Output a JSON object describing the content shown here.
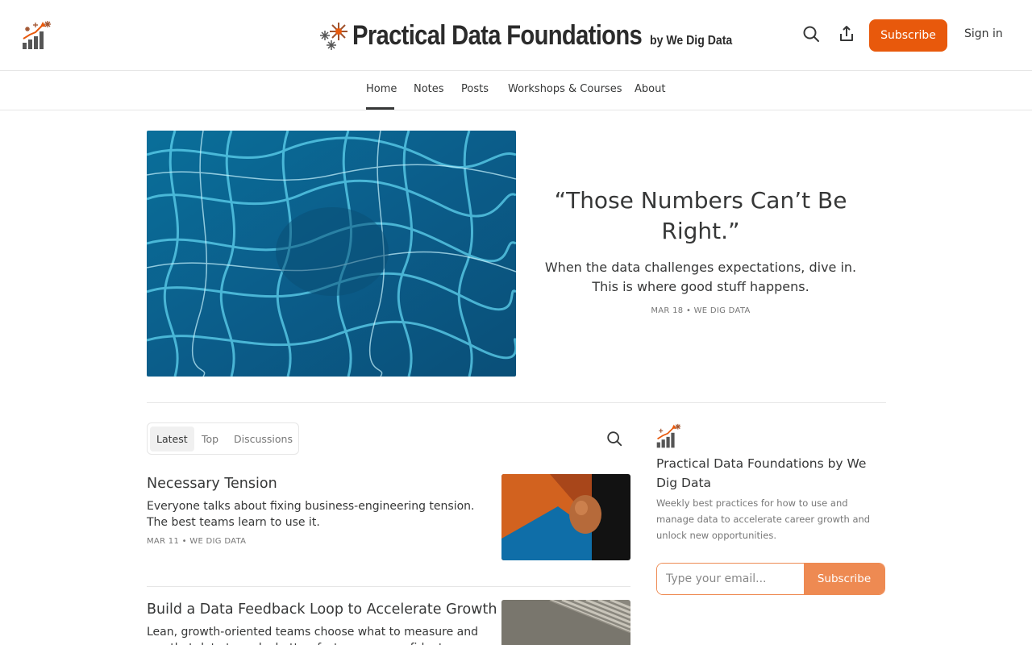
{
  "header": {
    "title": "Practical Data Foundations",
    "byline": "by We Dig Data",
    "subscribe_label": "Subscribe",
    "signin_label": "Sign in",
    "accent_color": "#e8590c"
  },
  "nav": {
    "items": [
      {
        "label": "Home",
        "active": true
      },
      {
        "label": "Notes"
      },
      {
        "label": "Posts"
      },
      {
        "label": "Workshops & Courses"
      },
      {
        "label": "About"
      }
    ]
  },
  "hero": {
    "title": "“Those Numbers Can’t Be Right.”",
    "subtitle": "When the data challenges expectations, dive in. This is where good stuff happens.",
    "meta": "MAR 18 • WE DIG DATA"
  },
  "feed": {
    "tabs": [
      {
        "label": "Latest",
        "active": true
      },
      {
        "label": "Top"
      },
      {
        "label": "Discussions"
      }
    ],
    "posts": [
      {
        "title": "Necessary Tension",
        "description": "Everyone talks about fixing business-engineering tension. The best teams learn to use it.",
        "meta": "MAR 11 • WE DIG DATA"
      },
      {
        "title": "Build a Data Feedback Loop to Accelerate Growth",
        "description": "Lean, growth-oriented teams choose what to measure and use that data to make better, faster, more confident decisions."
      }
    ]
  },
  "sidebar": {
    "title": "Practical Data Foundations by We Dig Data",
    "description": "Weekly best practices for how to use and manage data to accelerate career growth and unlock new opportunities.",
    "email_placeholder": "Type your email...",
    "subscribe_label": "Subscribe",
    "accent_color": "#ee8a52"
  },
  "icons": [
    "logo-chart-icon",
    "search-icon",
    "share-icon"
  ]
}
